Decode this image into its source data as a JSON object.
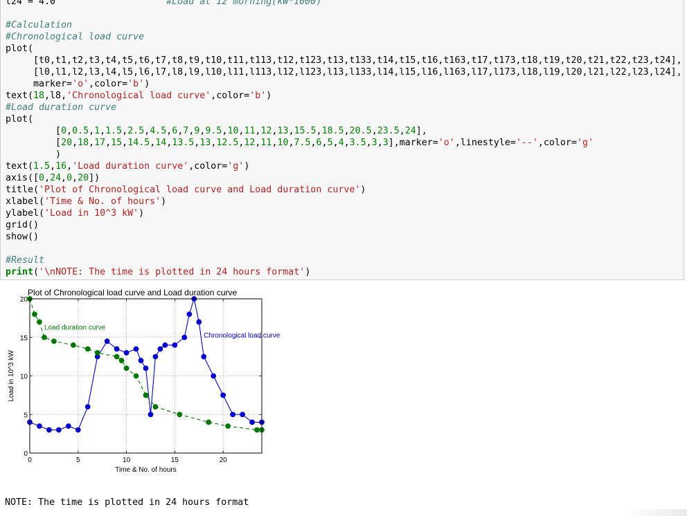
{
  "code": {
    "lines": [
      {
        "parts": [
          {
            "t": "t24 = 4.0",
            "c": ""
          },
          {
            "t": "                    #Load at 12 morning(kW*1000)",
            "c": "cm"
          }
        ]
      },
      {
        "parts": [
          {
            "t": "",
            "c": ""
          }
        ]
      },
      {
        "parts": [
          {
            "t": "#Calculation",
            "c": "cm"
          }
        ]
      },
      {
        "parts": [
          {
            "t": "#Chronological load curve",
            "c": "cm"
          }
        ]
      },
      {
        "parts": [
          {
            "t": "plot(",
            "c": ""
          }
        ]
      },
      {
        "parts": [
          {
            "t": "     [t0,t1,t2,t3,t4,t5,t6,t7,t8,t9,t10,t11,t113,t12,t123,t13,t133,t14,t15,t16,t163,t17,t173,t18,t19,t20,t21,t22,t23,t24],",
            "c": ""
          }
        ]
      },
      {
        "parts": [
          {
            "t": "     [l0,l1,l2,l3,l4,l5,l6,l7,l8,l9,l10,l11,l113,l12,l123,l13,l133,l14,l15,l16,l163,l17,l173,l18,l19,l20,l21,l22,l23,l24],",
            "c": ""
          }
        ]
      },
      {
        "parts": [
          {
            "t": "     marker=",
            "c": ""
          },
          {
            "t": "'o'",
            "c": "st"
          },
          {
            "t": ",color=",
            "c": ""
          },
          {
            "t": "'b'",
            "c": "st"
          },
          {
            "t": ")",
            "c": ""
          }
        ]
      },
      {
        "parts": [
          {
            "t": "text(",
            "c": ""
          },
          {
            "t": "18",
            "c": "nu"
          },
          {
            "t": ",l8,",
            "c": ""
          },
          {
            "t": "'Chronological load curve'",
            "c": "st"
          },
          {
            "t": ",color=",
            "c": ""
          },
          {
            "t": "'b'",
            "c": "st"
          },
          {
            "t": ")",
            "c": ""
          }
        ]
      },
      {
        "parts": [
          {
            "t": "#Load duration curve",
            "c": "cm"
          }
        ]
      },
      {
        "parts": [
          {
            "t": "plot(",
            "c": ""
          }
        ]
      },
      {
        "parts": [
          {
            "t": "         [",
            "c": ""
          },
          {
            "t": "0",
            "c": "nu"
          },
          {
            "t": ",",
            "c": ""
          },
          {
            "t": "0.5",
            "c": "nu"
          },
          {
            "t": ",",
            "c": ""
          },
          {
            "t": "1",
            "c": "nu"
          },
          {
            "t": ",",
            "c": ""
          },
          {
            "t": "1.5",
            "c": "nu"
          },
          {
            "t": ",",
            "c": ""
          },
          {
            "t": "2.5",
            "c": "nu"
          },
          {
            "t": ",",
            "c": ""
          },
          {
            "t": "4.5",
            "c": "nu"
          },
          {
            "t": ",",
            "c": ""
          },
          {
            "t": "6",
            "c": "nu"
          },
          {
            "t": ",",
            "c": ""
          },
          {
            "t": "7",
            "c": "nu"
          },
          {
            "t": ",",
            "c": ""
          },
          {
            "t": "9",
            "c": "nu"
          },
          {
            "t": ",",
            "c": ""
          },
          {
            "t": "9.5",
            "c": "nu"
          },
          {
            "t": ",",
            "c": ""
          },
          {
            "t": "10",
            "c": "nu"
          },
          {
            "t": ",",
            "c": ""
          },
          {
            "t": "11",
            "c": "nu"
          },
          {
            "t": ",",
            "c": ""
          },
          {
            "t": "12",
            "c": "nu"
          },
          {
            "t": ",",
            "c": ""
          },
          {
            "t": "13",
            "c": "nu"
          },
          {
            "t": ",",
            "c": ""
          },
          {
            "t": "15.5",
            "c": "nu"
          },
          {
            "t": ",",
            "c": ""
          },
          {
            "t": "18.5",
            "c": "nu"
          },
          {
            "t": ",",
            "c": ""
          },
          {
            "t": "20.5",
            "c": "nu"
          },
          {
            "t": ",",
            "c": ""
          },
          {
            "t": "23.5",
            "c": "nu"
          },
          {
            "t": ",",
            "c": ""
          },
          {
            "t": "24",
            "c": "nu"
          },
          {
            "t": "],",
            "c": ""
          }
        ]
      },
      {
        "parts": [
          {
            "t": "         [",
            "c": ""
          },
          {
            "t": "20",
            "c": "nu"
          },
          {
            "t": ",",
            "c": ""
          },
          {
            "t": "18",
            "c": "nu"
          },
          {
            "t": ",",
            "c": ""
          },
          {
            "t": "17",
            "c": "nu"
          },
          {
            "t": ",",
            "c": ""
          },
          {
            "t": "15",
            "c": "nu"
          },
          {
            "t": ",",
            "c": ""
          },
          {
            "t": "14.5",
            "c": "nu"
          },
          {
            "t": ",",
            "c": ""
          },
          {
            "t": "14",
            "c": "nu"
          },
          {
            "t": ",",
            "c": ""
          },
          {
            "t": "13.5",
            "c": "nu"
          },
          {
            "t": ",",
            "c": ""
          },
          {
            "t": "13",
            "c": "nu"
          },
          {
            "t": ",",
            "c": ""
          },
          {
            "t": "12.5",
            "c": "nu"
          },
          {
            "t": ",",
            "c": ""
          },
          {
            "t": "12",
            "c": "nu"
          },
          {
            "t": ",",
            "c": ""
          },
          {
            "t": "11",
            "c": "nu"
          },
          {
            "t": ",",
            "c": ""
          },
          {
            "t": "10",
            "c": "nu"
          },
          {
            "t": ",",
            "c": ""
          },
          {
            "t": "7.5",
            "c": "nu"
          },
          {
            "t": ",",
            "c": ""
          },
          {
            "t": "6",
            "c": "nu"
          },
          {
            "t": ",",
            "c": ""
          },
          {
            "t": "5",
            "c": "nu"
          },
          {
            "t": ",",
            "c": ""
          },
          {
            "t": "4",
            "c": "nu"
          },
          {
            "t": ",",
            "c": ""
          },
          {
            "t": "3.5",
            "c": "nu"
          },
          {
            "t": ",",
            "c": ""
          },
          {
            "t": "3",
            "c": "nu"
          },
          {
            "t": ",",
            "c": ""
          },
          {
            "t": "3",
            "c": "nu"
          },
          {
            "t": "],marker=",
            "c": ""
          },
          {
            "t": "'o'",
            "c": "st"
          },
          {
            "t": ",linestyle=",
            "c": ""
          },
          {
            "t": "'--'",
            "c": "st"
          },
          {
            "t": ",color=",
            "c": ""
          },
          {
            "t": "'g'",
            "c": "st"
          }
        ]
      },
      {
        "parts": [
          {
            "t": "         )",
            "c": ""
          }
        ]
      },
      {
        "parts": [
          {
            "t": "text(",
            "c": ""
          },
          {
            "t": "1.5",
            "c": "nu"
          },
          {
            "t": ",",
            "c": ""
          },
          {
            "t": "16",
            "c": "nu"
          },
          {
            "t": ",",
            "c": ""
          },
          {
            "t": "'Load duration curve'",
            "c": "st"
          },
          {
            "t": ",color=",
            "c": ""
          },
          {
            "t": "'g'",
            "c": "st"
          },
          {
            "t": ")",
            "c": ""
          }
        ]
      },
      {
        "parts": [
          {
            "t": "axis([",
            "c": ""
          },
          {
            "t": "0",
            "c": "nu"
          },
          {
            "t": ",",
            "c": ""
          },
          {
            "t": "24",
            "c": "nu"
          },
          {
            "t": ",",
            "c": ""
          },
          {
            "t": "0",
            "c": "nu"
          },
          {
            "t": ",",
            "c": ""
          },
          {
            "t": "20",
            "c": "nu"
          },
          {
            "t": "])",
            "c": ""
          }
        ]
      },
      {
        "parts": [
          {
            "t": "title(",
            "c": ""
          },
          {
            "t": "'Plot of Chronological load curve and Load duration curve'",
            "c": "st"
          },
          {
            "t": ")",
            "c": ""
          }
        ]
      },
      {
        "parts": [
          {
            "t": "xlabel(",
            "c": ""
          },
          {
            "t": "'Time & No. of hours'",
            "c": "st"
          },
          {
            "t": ")",
            "c": ""
          }
        ]
      },
      {
        "parts": [
          {
            "t": "ylabel(",
            "c": ""
          },
          {
            "t": "'Load in 10^3 kW'",
            "c": "st"
          },
          {
            "t": ")",
            "c": ""
          }
        ]
      },
      {
        "parts": [
          {
            "t": "grid()",
            "c": ""
          }
        ]
      },
      {
        "parts": [
          {
            "t": "show()",
            "c": ""
          }
        ]
      },
      {
        "parts": [
          {
            "t": "",
            "c": ""
          }
        ]
      },
      {
        "parts": [
          {
            "t": "#Result",
            "c": "cm"
          }
        ]
      },
      {
        "parts": [
          {
            "t": "print",
            "c": "kw"
          },
          {
            "t": "(",
            "c": ""
          },
          {
            "t": "'\\nNOTE: The time is plotted in 24 hours format'",
            "c": "st"
          },
          {
            "t": ")",
            "c": ""
          }
        ]
      }
    ]
  },
  "output": {
    "note": "NOTE: The time is plotted in 24 hours format"
  },
  "colors": {
    "chronological": "#0000cc",
    "duration": "#007700"
  },
  "chart_data": {
    "type": "line",
    "title": "Plot of Chronological load curve and Load duration curve",
    "xlabel": "Time & No. of hours",
    "ylabel": "Load in 10^3 kW",
    "xlim": [
      0,
      24
    ],
    "ylim": [
      0,
      20
    ],
    "x_ticks": [
      0,
      5,
      10,
      15,
      20
    ],
    "y_ticks": [
      0,
      5,
      10,
      15,
      20
    ],
    "grid": true,
    "series": [
      {
        "name": "Chronological load curve",
        "color": "blue",
        "linestyle": "solid",
        "marker": "o",
        "x": [
          0,
          1,
          2,
          3,
          4,
          5,
          6,
          7,
          8,
          9,
          10,
          11,
          11.5,
          12,
          12.5,
          13,
          13.5,
          14,
          15,
          16,
          16.5,
          17,
          17.5,
          18,
          19,
          20,
          21,
          22,
          23,
          24
        ],
        "y": [
          4,
          3.5,
          3,
          3,
          3.5,
          3,
          6,
          12.5,
          14.5,
          13.5,
          13,
          13.5,
          12,
          11,
          5,
          12.5,
          13.5,
          14,
          14,
          15,
          18,
          20,
          17,
          12.5,
          10,
          7.5,
          5,
          5,
          4,
          4
        ]
      },
      {
        "name": "Load duration curve",
        "color": "green",
        "linestyle": "dashed",
        "marker": "o",
        "x": [
          0,
          0.5,
          1,
          1.5,
          2.5,
          4.5,
          6,
          7,
          9,
          9.5,
          10,
          11,
          12,
          13,
          15.5,
          18.5,
          20.5,
          23.5,
          24
        ],
        "y": [
          20,
          18,
          17,
          15,
          14.5,
          14,
          13.5,
          13,
          12.5,
          12,
          11,
          10,
          7.5,
          6,
          5,
          4,
          3.5,
          3,
          3
        ]
      }
    ],
    "annotations": [
      {
        "text": "Chronological load curve",
        "x": 18,
        "y": 15,
        "color": "blue"
      },
      {
        "text": "Load duration curve",
        "x": 1.5,
        "y": 16,
        "color": "green"
      }
    ]
  }
}
